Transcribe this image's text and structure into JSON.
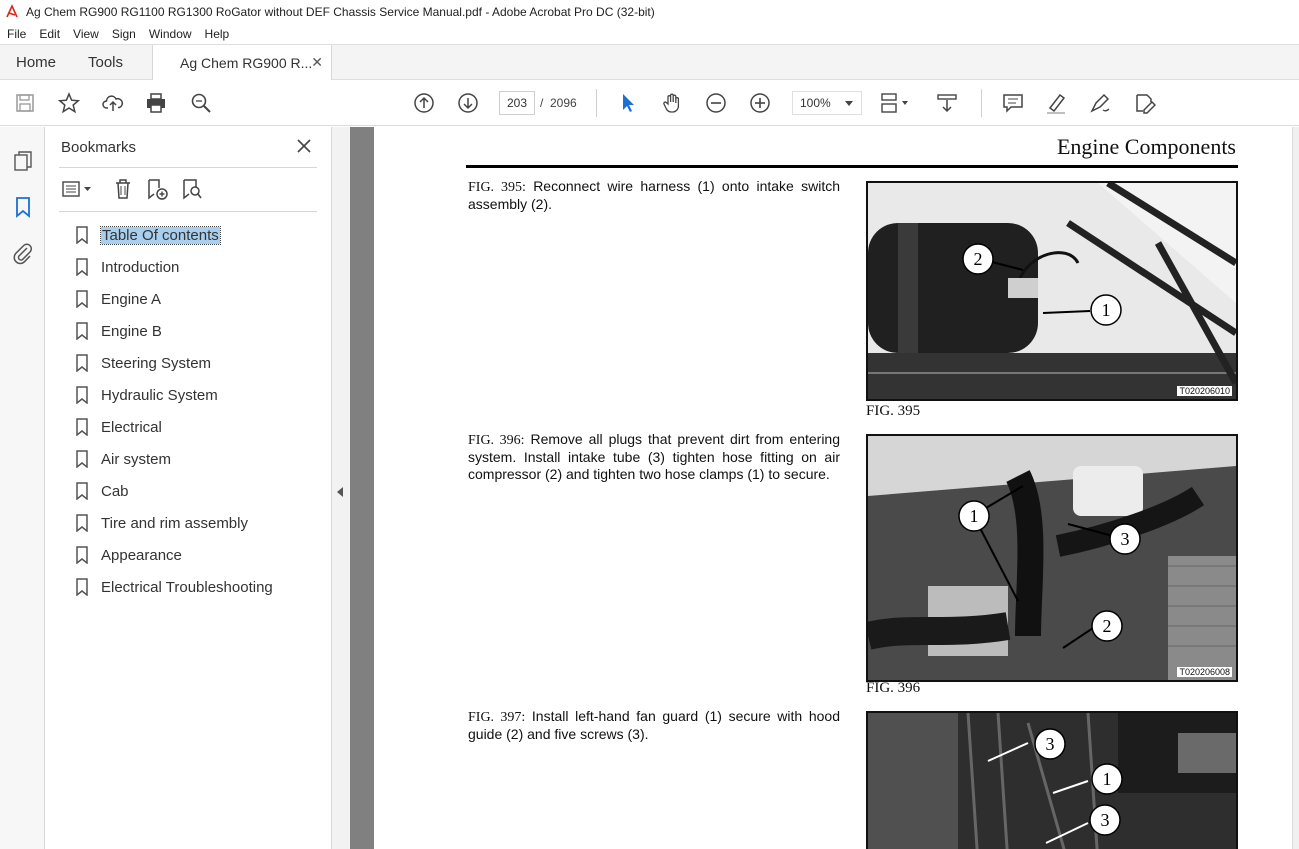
{
  "window": {
    "title": "Ag Chem RG900 RG1100 RG1300 RoGator without DEF Chassis Service Manual.pdf - Adobe Acrobat Pro DC (32-bit)"
  },
  "menu": [
    "File",
    "Edit",
    "View",
    "Sign",
    "Window",
    "Help"
  ],
  "tabs": {
    "home": "Home",
    "tools": "Tools",
    "document": "Ag Chem RG900 R..."
  },
  "toolbar": {
    "current_page": "203",
    "page_separator": "/",
    "total_pages": "2096",
    "zoom": "100%"
  },
  "bookmarks": {
    "title": "Bookmarks",
    "items": [
      "Table Of contents",
      "Introduction",
      "Engine A",
      "Engine B",
      "Steering System",
      "Hydraulic System",
      "Electrical",
      "Air system",
      "Cab",
      "Tire and rim assembly",
      "Appearance",
      "Electrical Troubleshooting"
    ],
    "selected_index": 0
  },
  "document": {
    "heading": "Engine Components",
    "figures": [
      {
        "label": "FIG. 395:",
        "text": "Reconnect wire harness (1) onto intake switch assembly (2).",
        "caption": "FIG. 395",
        "code": "T020206010",
        "callouts": [
          "2",
          "1"
        ]
      },
      {
        "label": "FIG. 396:",
        "text": "Remove all plugs that prevent dirt from entering system. Install intake tube (3) tighten hose fitting on air compressor (2) and tighten two hose clamps (1) to secure.",
        "caption": "FIG. 396",
        "code": "T020206008",
        "callouts": [
          "1",
          "3",
          "2"
        ]
      },
      {
        "label": "FIG. 397:",
        "text": "Install left-hand fan guard (1) secure with hood guide (2) and five screws (3).",
        "caption": "",
        "code": "",
        "callouts": [
          "3",
          "1",
          "3"
        ]
      }
    ]
  }
}
